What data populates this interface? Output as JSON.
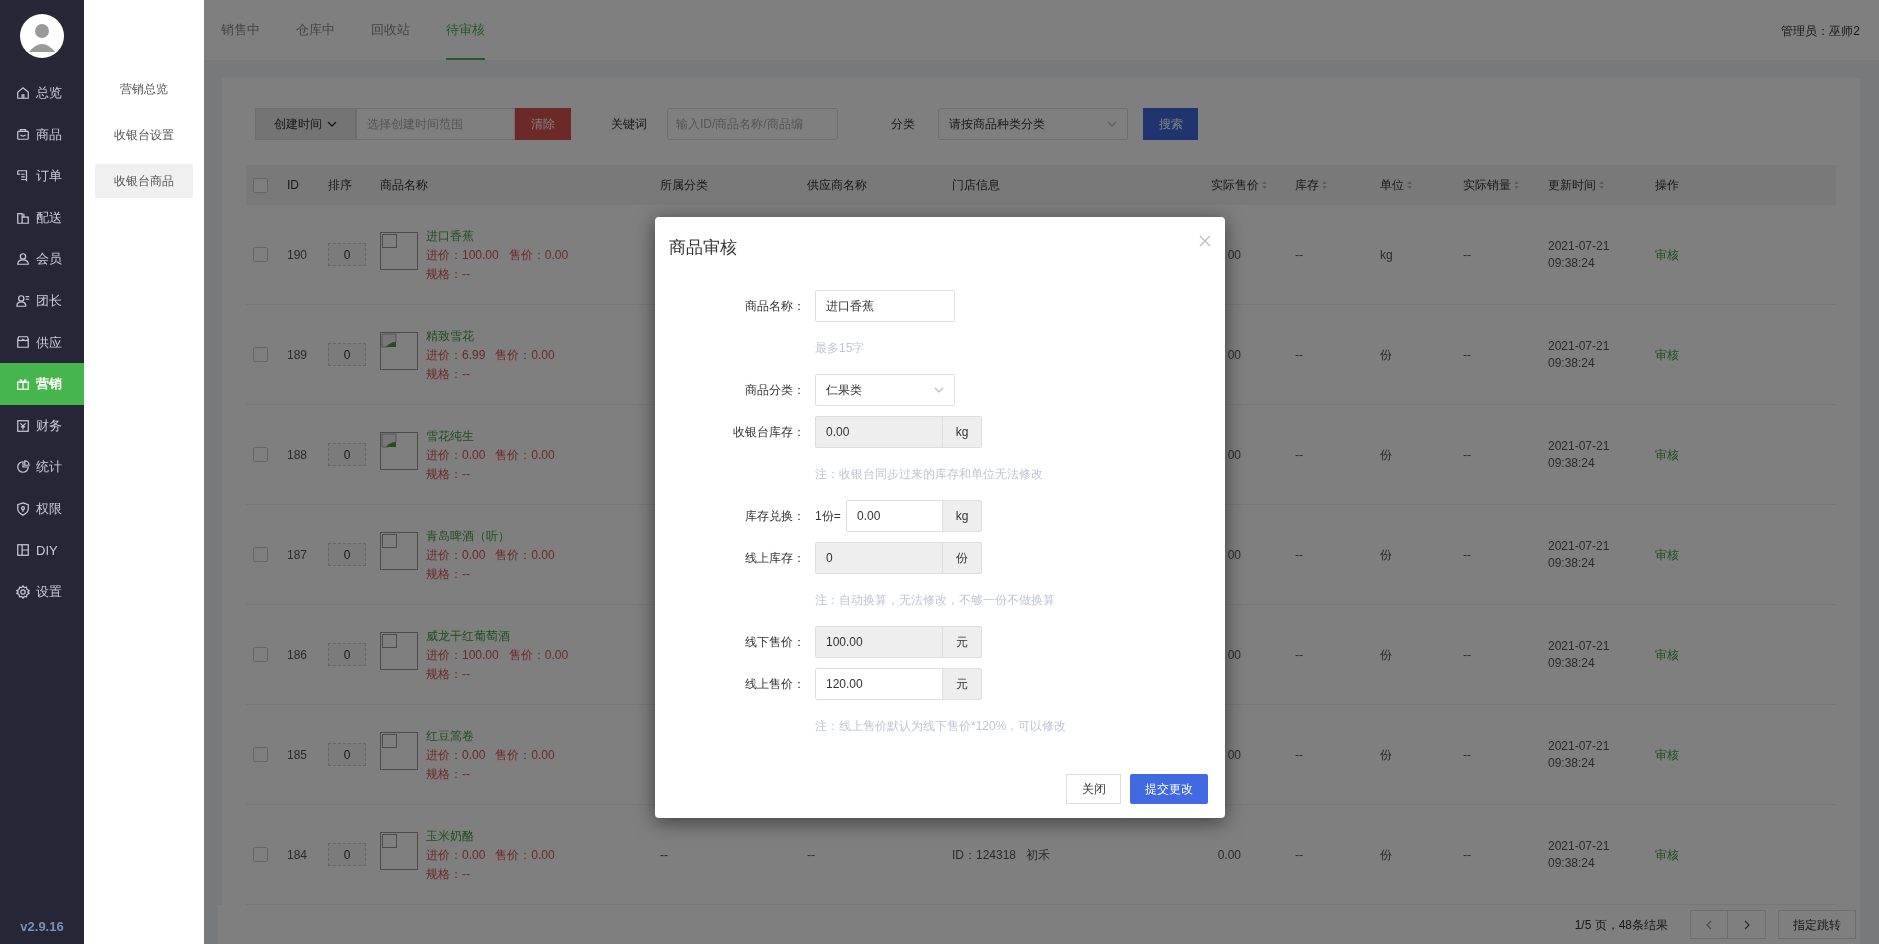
{
  "sidebar": {
    "items": [
      {
        "label": "总览",
        "selected": false
      },
      {
        "label": "商品",
        "selected": false
      },
      {
        "label": "订单",
        "selected": false
      },
      {
        "label": "配送",
        "selected": false
      },
      {
        "label": "会员",
        "selected": false
      },
      {
        "label": "团长",
        "selected": false
      },
      {
        "label": "供应",
        "selected": false
      },
      {
        "label": "营销",
        "selected": true
      },
      {
        "label": "财务",
        "selected": false
      },
      {
        "label": "统计",
        "selected": false
      },
      {
        "label": "权限",
        "selected": false
      },
      {
        "label": "DIY",
        "selected": false
      },
      {
        "label": "设置",
        "selected": false
      }
    ],
    "version": "v2.9.16"
  },
  "submenu": [
    {
      "label": "营销总览",
      "selected": false
    },
    {
      "label": "收银台设置",
      "selected": false
    },
    {
      "label": "收银台商品",
      "selected": true
    }
  ],
  "tabs": [
    {
      "label": "销售中",
      "selected": false
    },
    {
      "label": "仓库中",
      "selected": false
    },
    {
      "label": "回收站",
      "selected": false
    },
    {
      "label": "待审核",
      "selected": true
    }
  ],
  "admin": "管理员：巫师2",
  "filters": {
    "date_type": "创建时间",
    "date_placeholder": "选择创建时间范围",
    "clear": "清除",
    "keyword_label": "关键词",
    "keyword_placeholder": "输入ID/商品名称/商品编",
    "category_label": "分类",
    "category_placeholder": "请按商品种类分类",
    "search": "搜索"
  },
  "table": {
    "select_all": false,
    "columns": [
      {
        "label": "ID",
        "sortable": false
      },
      {
        "label": "排序",
        "sortable": false
      },
      {
        "label": "商品名称",
        "sortable": false
      },
      {
        "label": "所属分类",
        "sortable": false
      },
      {
        "label": "供应商名称",
        "sortable": false
      },
      {
        "label": "门店信息",
        "sortable": false
      },
      {
        "label": "实际售价",
        "sortable": true
      },
      {
        "label": "库存",
        "sortable": true
      },
      {
        "label": "单位",
        "sortable": true
      },
      {
        "label": "实际销量",
        "sortable": true
      },
      {
        "label": "更新时间",
        "sortable": true
      },
      {
        "label": "操作",
        "sortable": false
      }
    ],
    "rows": [
      {
        "checked": false,
        "id": "190",
        "sort": "0",
        "kind": "empty",
        "name": "进口香蕉",
        "cost": "进价：100.00",
        "price": "售价：0.00",
        "spec": "规格：--",
        "sale_price": "00",
        "stock": "--",
        "unit": "kg",
        "sales": "--",
        "date": "2021-07-21",
        "time": "09:38:24",
        "action": "审核"
      },
      {
        "checked": false,
        "id": "189",
        "sort": "0",
        "kind": "broken",
        "name": "精致雪花",
        "cost": "进价：6.99",
        "price": "售价：0.00",
        "spec": "规格：--",
        "sale_price": "00",
        "stock": "--",
        "unit": "份",
        "sales": "--",
        "date": "2021-07-21",
        "time": "09:38:24",
        "action": "审核"
      },
      {
        "checked": false,
        "id": "188",
        "sort": "0",
        "kind": "broken",
        "name": "雪花纯生",
        "cost": "进价：0.00",
        "price": "售价：0.00",
        "spec": "规格：--",
        "sale_price": "00",
        "stock": "--",
        "unit": "份",
        "sales": "--",
        "date": "2021-07-21",
        "time": "09:38:24",
        "action": "审核"
      },
      {
        "checked": false,
        "id": "187",
        "sort": "0",
        "kind": "empty",
        "name": "青岛啤酒（听）",
        "cost": "进价：0.00",
        "price": "售价：0.00",
        "spec": "规格：--",
        "sale_price": "00",
        "stock": "--",
        "unit": "份",
        "sales": "--",
        "date": "2021-07-21",
        "time": "09:38:24",
        "action": "审核"
      },
      {
        "checked": false,
        "id": "186",
        "sort": "0",
        "kind": "empty",
        "name": "威龙干红葡萄酒",
        "cost": "进价：100.00",
        "price": "售价：0.00",
        "spec": "规格：--",
        "sale_price": "00",
        "stock": "--",
        "unit": "份",
        "sales": "--",
        "date": "2021-07-21",
        "time": "09:38:24",
        "action": "审核"
      },
      {
        "checked": false,
        "id": "185",
        "sort": "0",
        "kind": "empty",
        "name": "红豆篙卷",
        "cost": "进价：0.00",
        "price": "售价：0.00",
        "spec": "规格：--",
        "sale_price": "00",
        "stock": "--",
        "unit": "份",
        "sales": "--",
        "date": "2021-07-21",
        "time": "09:38:24",
        "action": "审核"
      },
      {
        "checked": false,
        "id": "184",
        "sort": "0",
        "kind": "empty",
        "name": "玉米奶酪",
        "cost": "进价：0.00",
        "price": "售价：0.00",
        "spec": "规格：--",
        "category": "--",
        "supplier": "--",
        "store_id": "ID：124318",
        "store_name": "初禾",
        "sale_price": "0.00",
        "stock": "--",
        "unit": "份",
        "sales": "--",
        "date": "2021-07-21",
        "time": "09:38:24",
        "action": "审核"
      }
    ]
  },
  "pagination": {
    "summary": "1/5 页，48条结果",
    "jump": "指定跳转"
  },
  "dialog": {
    "title": "商品审核",
    "fields": [
      {
        "kind": "text",
        "label": "商品名称：",
        "value": "进口香蕉"
      },
      {
        "kind": "note",
        "text": "最多15字"
      },
      {
        "kind": "select",
        "label": "商品分类：",
        "value": "仁果类"
      },
      {
        "kind": "addon",
        "label": "收银台库存：",
        "value": "0.00",
        "suffix": "kg",
        "readonly": true
      },
      {
        "kind": "note",
        "text": "注：收银台同步过来的库存和单位无法修改"
      },
      {
        "kind": "addon",
        "label": "库存兑换：",
        "prefix": "1份=",
        "value": "0.00",
        "suffix": "kg",
        "readonly": false
      },
      {
        "kind": "addon",
        "label": "线上库存：",
        "value": "0",
        "suffix": "份",
        "readonly": true
      },
      {
        "kind": "note",
        "text": "注：自动换算，无法修改，不够一份不做换算"
      },
      {
        "kind": "addon",
        "label": "线下售价：",
        "value": "100.00",
        "suffix": "元",
        "readonly": true
      },
      {
        "kind": "addon",
        "label": "线上售价：",
        "value": "120.00",
        "suffix": "元",
        "readonly": false
      },
      {
        "kind": "note",
        "text": "注：线上售价默认为线下售价*120%，可以修改"
      }
    ],
    "cancel": "关闭",
    "submit": "提交更改"
  }
}
